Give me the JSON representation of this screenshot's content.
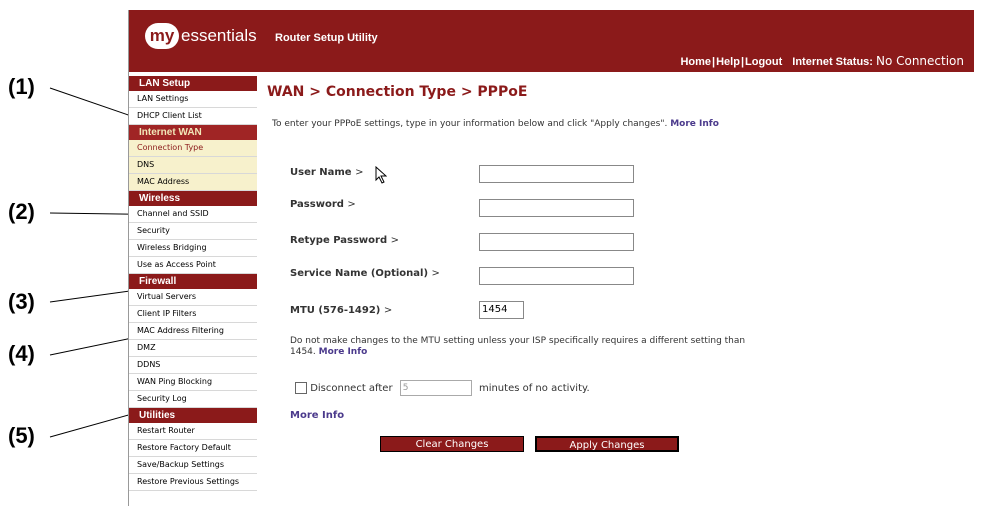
{
  "callouts": [
    "(1)",
    "(2)",
    "(3)",
    "(4)",
    "(5)"
  ],
  "header": {
    "logo_badge": "my",
    "logo_text": "essentials",
    "app_title": "Router Setup Utility",
    "nav": [
      "Home",
      "Help",
      "Logout"
    ],
    "status_label": "Internet Status:",
    "status_value": "No Connection"
  },
  "sidebar": {
    "sections": [
      {
        "title": "LAN Setup",
        "items": [
          "LAN Settings",
          "DHCP Client List"
        ]
      },
      {
        "title": "Internet WAN",
        "items": [
          "Connection Type",
          "DNS",
          "MAC Address"
        ]
      },
      {
        "title": "Wireless",
        "items": [
          "Channel and SSID",
          "Security",
          "Wireless Bridging",
          "Use as Access Point"
        ]
      },
      {
        "title": "Firewall",
        "items": [
          "Virtual Servers",
          "Client IP Filters",
          "MAC Address Filtering",
          "DMZ",
          "DDNS",
          "WAN Ping Blocking",
          "Security Log"
        ]
      },
      {
        "title": "Utilities",
        "items": [
          "Restart Router",
          "Restore Factory Default",
          "Save/Backup Settings",
          "Restore Previous Settings"
        ]
      }
    ]
  },
  "main": {
    "title": "WAN > Connection Type > PPPoE",
    "intro": "To enter your PPPoE settings, type in your information below and click \"Apply changes\".",
    "intro_link": "More Info",
    "fields": {
      "user_name": "User Name",
      "password": "Password",
      "retype_password": "Retype Password",
      "service_name": "Service Name (Optional)",
      "mtu": "MTU (576-1492)"
    },
    "gt": ">",
    "mtu_value": "1454",
    "mtu_note": "Do not make changes to the MTU setting unless your ISP specifically requires a different setting than 1454.",
    "mtu_note_link": "More Info",
    "disconnect_label": "Disconnect after",
    "minutes_value": "5",
    "minutes_suffix": "minutes of no activity.",
    "more_info": "More Info",
    "clear_button": "Clear Changes",
    "apply_button": "Apply Changes"
  }
}
